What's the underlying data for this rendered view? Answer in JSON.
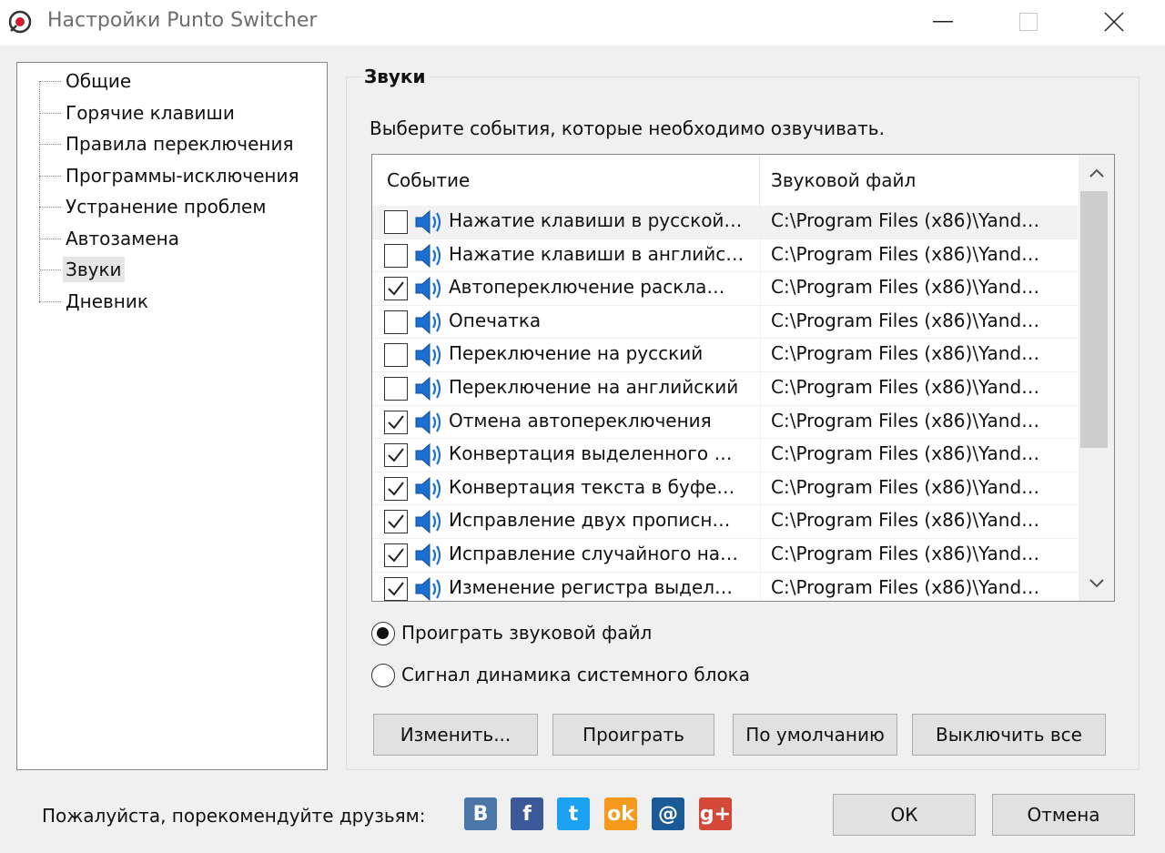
{
  "window": {
    "title": "Настройки Punto Switcher"
  },
  "tree": {
    "items": [
      {
        "label": "Общие"
      },
      {
        "label": "Горячие клавиши"
      },
      {
        "label": "Правила переключения"
      },
      {
        "label": "Программы-исключения"
      },
      {
        "label": "Устранение проблем"
      },
      {
        "label": "Автозамена"
      },
      {
        "label": "Звуки",
        "selected": true
      },
      {
        "label": "Дневник"
      }
    ]
  },
  "sounds": {
    "group_title": "Звуки",
    "description": "Выберите события, которые необходимо озвучивать.",
    "columns": {
      "event": "Событие",
      "file": "Звуковой файл"
    },
    "rows": [
      {
        "checked": false,
        "event": "Нажатие клавиши в русской…",
        "file": "C:\\Program Files (x86)\\Yand…"
      },
      {
        "checked": false,
        "event": "Нажатие клавиши в английс…",
        "file": "C:\\Program Files (x86)\\Yand…"
      },
      {
        "checked": true,
        "event": "Автопереключение раскла…",
        "file": "C:\\Program Files (x86)\\Yand…"
      },
      {
        "checked": false,
        "event": "Опечатка",
        "file": "C:\\Program Files (x86)\\Yand…"
      },
      {
        "checked": false,
        "event": "Переключение на русский",
        "file": "C:\\Program Files (x86)\\Yand…"
      },
      {
        "checked": false,
        "event": "Переключение на английский",
        "file": "C:\\Program Files (x86)\\Yand…"
      },
      {
        "checked": true,
        "event": "Отмена автопереключения",
        "file": "C:\\Program Files (x86)\\Yand…"
      },
      {
        "checked": true,
        "event": "Конвертация выделенного …",
        "file": "C:\\Program Files (x86)\\Yand…"
      },
      {
        "checked": true,
        "event": "Конвертация текста в буфе…",
        "file": "C:\\Program Files (x86)\\Yand…"
      },
      {
        "checked": true,
        "event": "Исправление двух прописн…",
        "file": "C:\\Program Files (x86)\\Yand…"
      },
      {
        "checked": true,
        "event": "Исправление случайного на…",
        "file": "C:\\Program Files (x86)\\Yand…"
      },
      {
        "checked": true,
        "event": "Изменение регистра выдел…",
        "file": "C:\\Program Files (x86)\\Yand…"
      }
    ],
    "radio_play_file": "Проиграть звуковой файл",
    "radio_speaker": "Сигнал динамика системного блока",
    "selected_radio": "play_file",
    "buttons": {
      "change": "Изменить...",
      "play": "Проиграть",
      "default": "По умолчанию",
      "disable_all": "Выключить все"
    }
  },
  "footer": {
    "recommend": "Пожалуйста, порекомендуйте друзьям:",
    "social": [
      {
        "icon": "vk-icon",
        "glyph": "B",
        "color": "#4a76a8"
      },
      {
        "icon": "facebook-icon",
        "glyph": "f",
        "color": "#3b5998"
      },
      {
        "icon": "twitter-icon",
        "glyph": "t",
        "color": "#1da1f2"
      },
      {
        "icon": "odnoklassniki-icon",
        "glyph": "ok",
        "color": "#f59a1d"
      },
      {
        "icon": "mailru-icon",
        "glyph": "@",
        "color": "#1a5a96"
      },
      {
        "icon": "googleplus-icon",
        "glyph": "g+",
        "color": "#d34836"
      }
    ],
    "ok": "ОК",
    "cancel": "Отмена"
  }
}
